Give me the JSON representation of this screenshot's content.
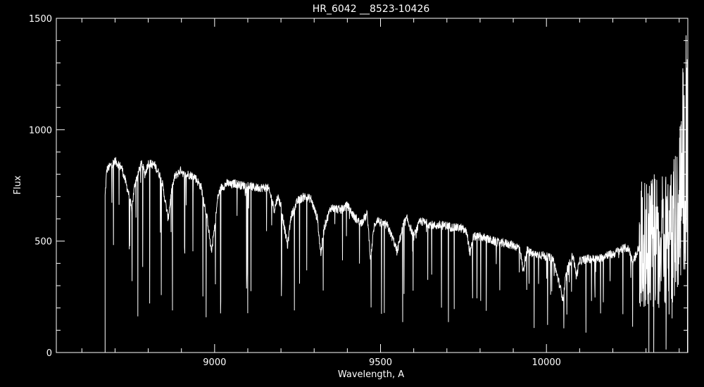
{
  "chart_data": {
    "type": "line",
    "title": "HR_6042 __8523-10426",
    "xlabel": "Wavelength, A",
    "ylabel": "Flux",
    "xlim": [
      8523,
      10426
    ],
    "ylim": [
      0,
      1500
    ],
    "x_ticks": [
      9000,
      9500,
      10000
    ],
    "y_ticks": [
      0,
      500,
      1000,
      1500
    ],
    "grid": false,
    "colors": {
      "background": "#000000",
      "foreground": "#ffffff"
    },
    "series": [
      {
        "x": [
          8670,
          8675,
          8700,
          8720,
          8740,
          8750,
          8760,
          8780,
          8790,
          8800,
          8820,
          8840,
          8860,
          8870,
          8880,
          8900,
          8910,
          8920,
          8940,
          8960,
          8980,
          8990,
          9000,
          9010,
          9020,
          9040,
          9050,
          9060,
          9080,
          9100,
          9120,
          9140,
          9160,
          9170,
          9180,
          9190,
          9200,
          9210,
          9220,
          9230,
          9250,
          9270,
          9290,
          9310,
          9320,
          9330,
          9350,
          9380,
          9400,
          9420,
          9440,
          9460,
          9470,
          9480,
          9490,
          9500,
          9520,
          9540,
          9550,
          9560,
          9570,
          9580,
          9600,
          9620,
          9640,
          9660,
          9680,
          9700,
          9720,
          9740,
          9760,
          9770,
          9780,
          9800,
          9820,
          9840,
          9860,
          9880,
          9900,
          9920,
          9930,
          9940,
          9960,
          9980,
          10000,
          10020,
          10040,
          10050,
          10060,
          10080,
          10090,
          10100,
          10120,
          10140,
          10160,
          10180,
          10200,
          10220,
          10240,
          10250,
          10260,
          10280,
          10300,
          10320,
          10340,
          10360,
          10380,
          10400,
          10410,
          10420,
          10426
        ],
        "y": [
          700,
          820,
          860,
          830,
          720,
          640,
          760,
          850,
          800,
          850,
          840,
          780,
          600,
          720,
          790,
          820,
          790,
          800,
          790,
          740,
          580,
          450,
          560,
          700,
          740,
          760,
          750,
          760,
          750,
          750,
          740,
          740,
          740,
          700,
          640,
          700,
          660,
          560,
          480,
          610,
          680,
          700,
          690,
          600,
          440,
          560,
          650,
          640,
          660,
          610,
          580,
          620,
          420,
          560,
          600,
          580,
          570,
          500,
          450,
          520,
          580,
          600,
          520,
          590,
          580,
          570,
          570,
          570,
          560,
          560,
          540,
          440,
          520,
          520,
          510,
          500,
          490,
          490,
          480,
          470,
          360,
          460,
          440,
          440,
          430,
          420,
          300,
          240,
          360,
          440,
          340,
          410,
          420,
          420,
          420,
          440,
          440,
          460,
          470,
          460,
          400,
          480,
          480,
          500,
          500,
          520,
          540,
          620,
          800,
          900,
          900
        ]
      }
    ]
  }
}
